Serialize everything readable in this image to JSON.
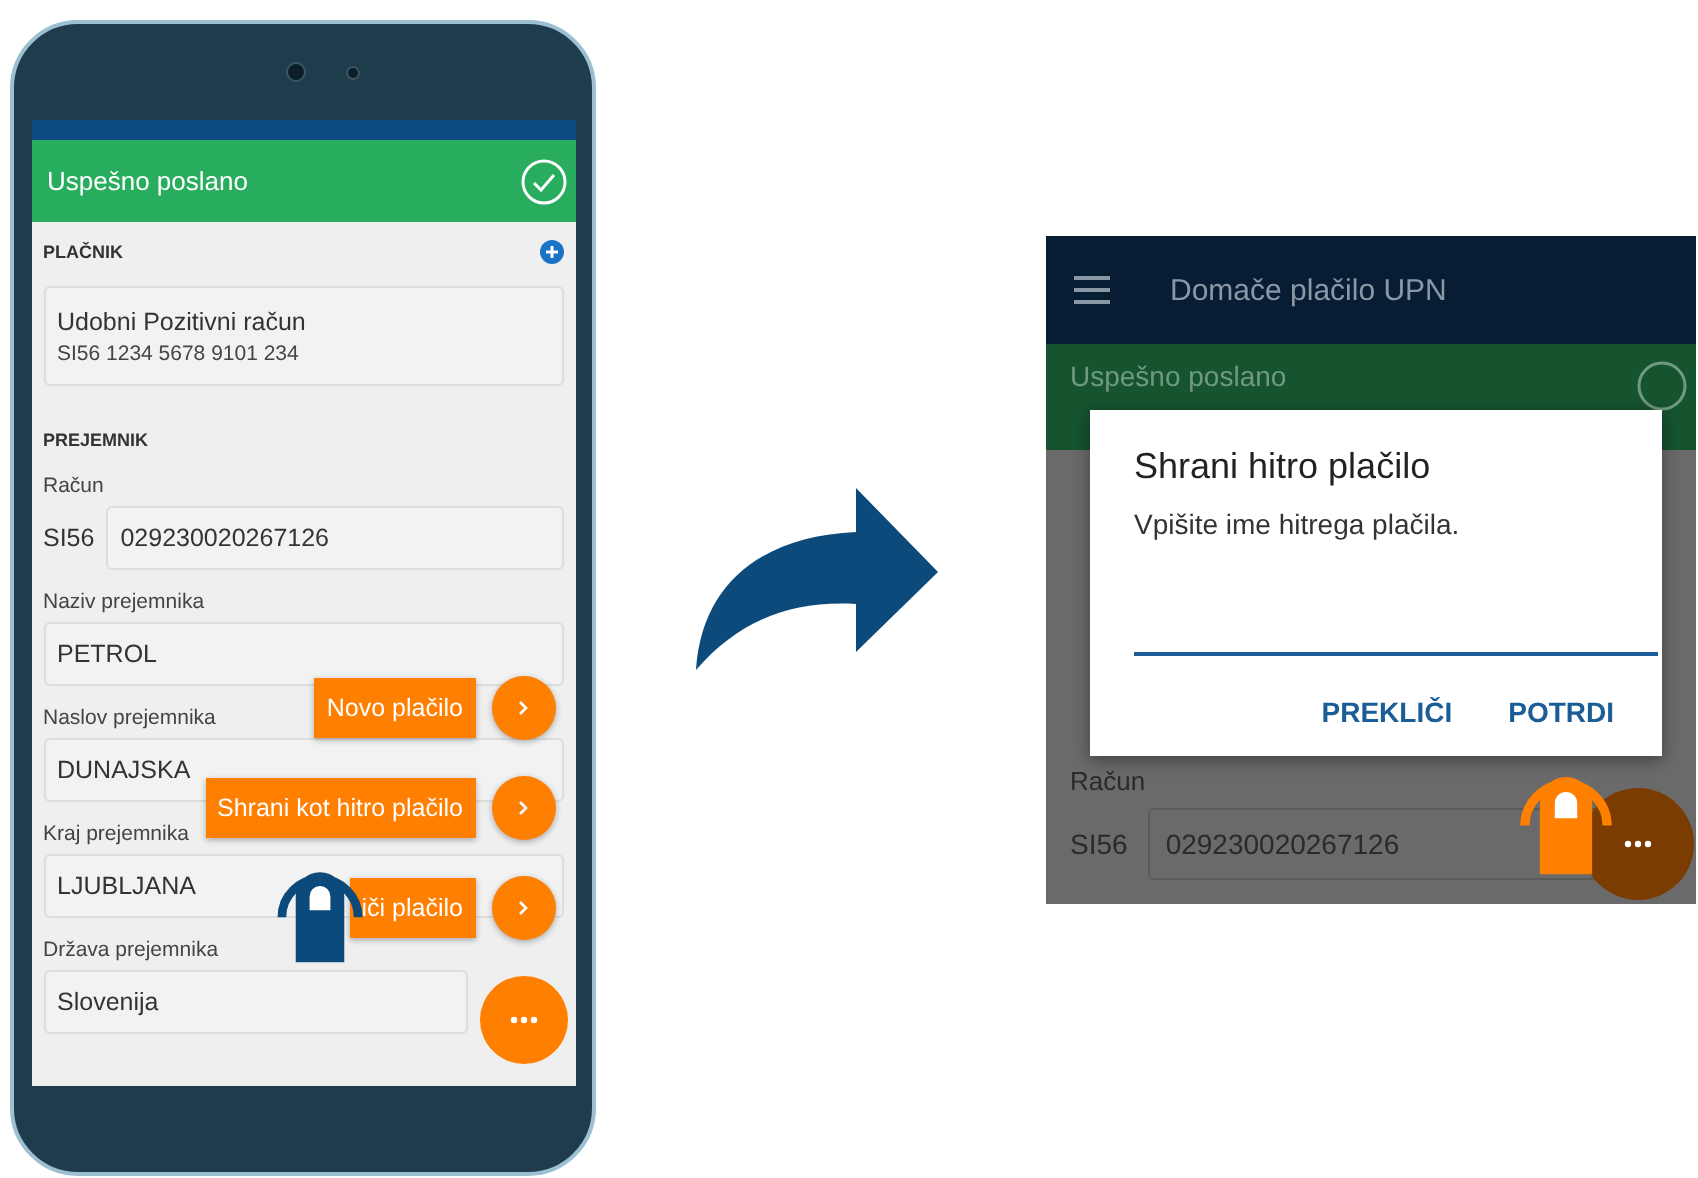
{
  "phone": {
    "banner": {
      "text": "Uspešno poslano",
      "success": true
    },
    "payer": {
      "heading": "PLAČNIK",
      "account_name": "Udobni Pozitivni račun",
      "iban": "SI56 1234 5678 9101 234"
    },
    "recipient": {
      "heading": "PREJEMNIK",
      "account_label": "Račun",
      "account_prefix": "SI56",
      "account_number": "029230020267126",
      "fields": [
        {
          "label": "Naziv prejemnika",
          "value": "PETROL"
        },
        {
          "label": "Naslov prejemnika",
          "value": "DUNAJSKA"
        },
        {
          "label": "Kraj prejemnika",
          "value": "LJUBLJANA"
        },
        {
          "label": "Država prejemnika",
          "value": "Slovenija"
        }
      ]
    },
    "fab_menu": {
      "items": [
        "Novo plačilo",
        "Shrani kot hitro plačilo",
        "iči plačilo"
      ]
    }
  },
  "dialog_screen": {
    "app_bar": {
      "title": "Domače plačilo UPN"
    },
    "banner": {
      "text": "Uspešno poslano"
    },
    "account_label": "Račun",
    "account_prefix": "SI56",
    "account_number": "029230020267126",
    "dialog": {
      "title": "Shrani hitro plačilo",
      "message": "Vpišite ime hitrega plačila.",
      "buttons": [
        "PREKLIČI",
        "POTRDI"
      ]
    }
  }
}
